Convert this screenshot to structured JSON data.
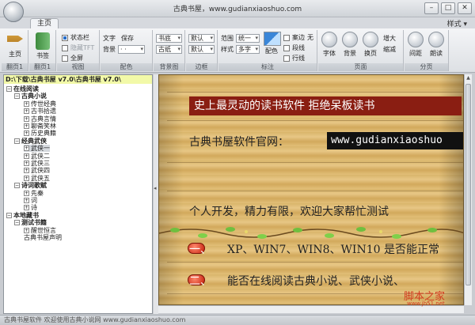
{
  "window": {
    "title": "古典书屋，www.gudianxiaoshuo.com",
    "min": "–",
    "max": "□",
    "close": "✕"
  },
  "ribbon": {
    "tab_main": "主页",
    "style_menu": "样式 ▾",
    "groups": {
      "g1": "翻页1",
      "g2": "翻页1",
      "g3": "视图",
      "g4": "配色",
      "g5": "背景图",
      "g6": "边框",
      "g7": "标注",
      "g8": "页面",
      "g9": "分页"
    },
    "home_btn": "主页",
    "bookmark_btn": "书签",
    "status_bar_cb": "状态栏",
    "mask_cb": "隐藏TFT",
    "fullscreen_cb": "全屏",
    "text_label": "文字",
    "text_value": "保存",
    "bg_label": "背景",
    "bg_value": "· ·",
    "font_dd1": "书底",
    "font_dd2": "古纸",
    "default_dd1": "默认",
    "default_dd2": "默认",
    "range_label": "范围",
    "range_value": "统一",
    "style_label": "样式",
    "style_value": "多字",
    "color_btn": "配色",
    "indent_cb": "案边",
    "indent_val": "无",
    "segment_cb": "段线",
    "row_cb": "行线",
    "font_btn": "字体",
    "bg_btn": "背景",
    "page_btn": "换页",
    "zoom_in": "增大",
    "zoom_out": "缩减",
    "spacing_btn": "间距",
    "read_btn": "朗读"
  },
  "tree": {
    "path": "D:\\下载\\古典书屋 v7.0\\古典书屋 v7.0\\",
    "nodes": [
      {
        "label": "在线阅读",
        "box": "−",
        "level": 0
      },
      {
        "label": "古典小说",
        "box": "−",
        "level": 1
      },
      {
        "label": "传世经典",
        "box": "+",
        "level": 2
      },
      {
        "label": "古书拾遗",
        "box": "+",
        "level": 2
      },
      {
        "label": "古典言情",
        "box": "+",
        "level": 2
      },
      {
        "label": "聊斋笑林",
        "box": "+",
        "level": 2
      },
      {
        "label": "历史典籍",
        "box": "+",
        "level": 2
      },
      {
        "label": "经典武侠",
        "box": "−",
        "level": 1
      },
      {
        "label": "武侠一",
        "box": "+",
        "level": 2
      },
      {
        "label": "武侠二",
        "box": "+",
        "level": 2
      },
      {
        "label": "武侠三",
        "box": "+",
        "level": 2
      },
      {
        "label": "武侠四",
        "box": "+",
        "level": 2
      },
      {
        "label": "武侠五",
        "box": "+",
        "level": 2
      },
      {
        "label": "诗词歌赋",
        "box": "−",
        "level": 1
      },
      {
        "label": "先秦",
        "box": "+",
        "level": 2
      },
      {
        "label": "词",
        "box": "+",
        "level": 2
      },
      {
        "label": "诗",
        "box": "+",
        "level": 2
      },
      {
        "label": "本地藏书",
        "box": "−",
        "level": 0
      },
      {
        "label": "测试书籍",
        "box": "−",
        "level": 1
      },
      {
        "label": "醒世恒言",
        "box": "+",
        "level": 2
      },
      {
        "label": "古典书屋声明",
        "box": "",
        "level": 2
      }
    ],
    "splitter": "◂"
  },
  "reader": {
    "slogan": "史上最灵动的读书软件  拒绝呆板读书",
    "site_label": "古典书屋软件官网：",
    "site_url": "www.gudianxiaoshuo",
    "line3": "个人开发，精力有限，欢迎大家帮忙测试",
    "line4_num": "一、",
    "line4": "XP、WIN7、WIN8、WIN10 是否能正常",
    "line5_num": "二、",
    "line5": "能否在线阅读古典小说、武侠小说、"
  },
  "watermark": {
    "main": "脚本之家",
    "sub": "www.jb51.net"
  },
  "status": "古典书屋软件 欢迎使用古典小说网 www.gudianxiaoshuo.com",
  "colors": {
    "slogan_bg": "#8a1e12",
    "paper": "#e2bf78",
    "bullet": "#c41c0a",
    "url_bg": "#111111"
  }
}
